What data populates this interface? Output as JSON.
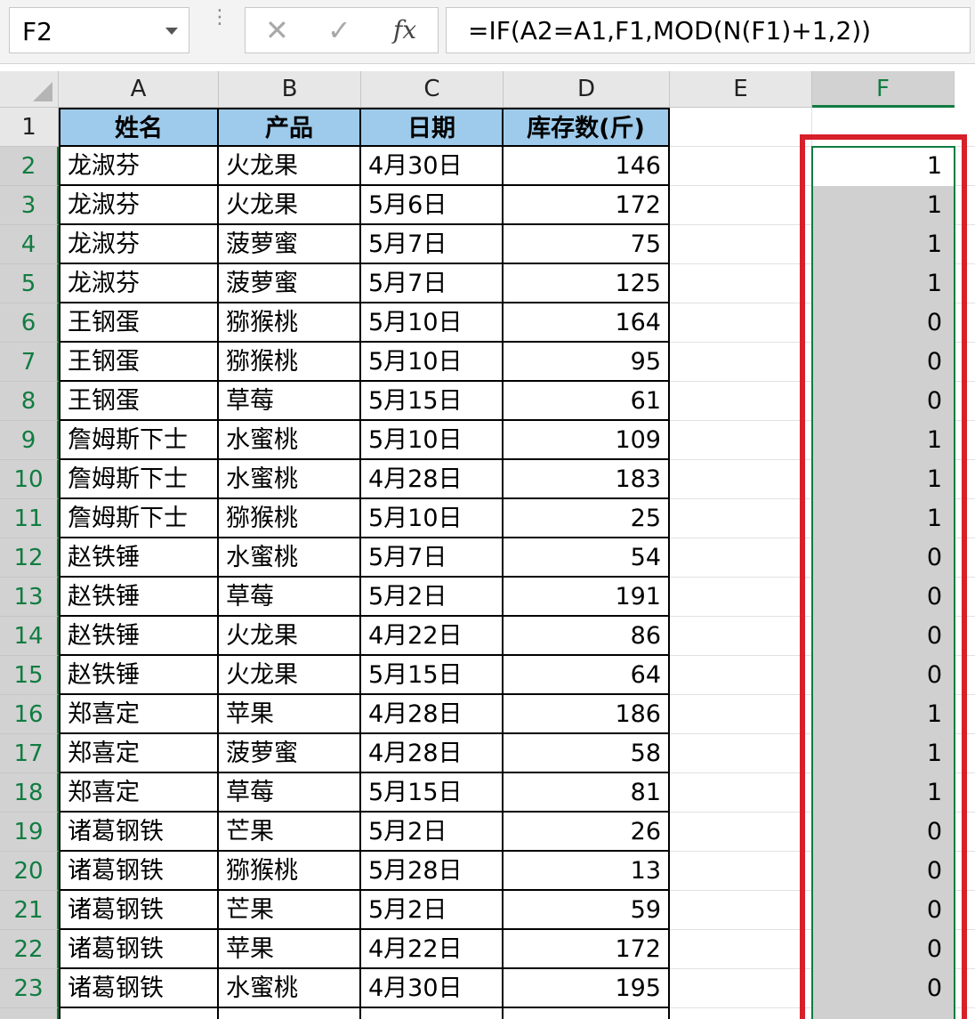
{
  "formula_bar": {
    "name_box": "F2",
    "dots": "⋮",
    "cancel": "✕",
    "enter": "✓",
    "fx": "fx",
    "formula": "=IF(A2=A1,F1,MOD(N(F1)+1,2))"
  },
  "columns": [
    "A",
    "B",
    "C",
    "D",
    "E",
    "F"
  ],
  "header_row": [
    "姓名",
    "产品",
    "日期",
    "库存数(斤)"
  ],
  "rows": [
    {
      "n": "1"
    },
    {
      "n": "2",
      "a": "龙淑芬",
      "b": "火龙果",
      "c": "4月30日",
      "d": "146",
      "f": "1"
    },
    {
      "n": "3",
      "a": "龙淑芬",
      "b": "火龙果",
      "c": "5月6日",
      "d": "172",
      "f": "1"
    },
    {
      "n": "4",
      "a": "龙淑芬",
      "b": "菠萝蜜",
      "c": "5月7日",
      "d": "75",
      "f": "1"
    },
    {
      "n": "5",
      "a": "龙淑芬",
      "b": "菠萝蜜",
      "c": "5月7日",
      "d": "125",
      "f": "1"
    },
    {
      "n": "6",
      "a": "王钢蛋",
      "b": "猕猴桃",
      "c": "5月10日",
      "d": "164",
      "f": "0"
    },
    {
      "n": "7",
      "a": "王钢蛋",
      "b": "猕猴桃",
      "c": "5月10日",
      "d": "95",
      "f": "0"
    },
    {
      "n": "8",
      "a": "王钢蛋",
      "b": "草莓",
      "c": "5月15日",
      "d": "61",
      "f": "0"
    },
    {
      "n": "9",
      "a": "詹姆斯下士",
      "b": "水蜜桃",
      "c": "5月10日",
      "d": "109",
      "f": "1"
    },
    {
      "n": "10",
      "a": "詹姆斯下士",
      "b": "水蜜桃",
      "c": "4月28日",
      "d": "183",
      "f": "1"
    },
    {
      "n": "11",
      "a": "詹姆斯下士",
      "b": "猕猴桃",
      "c": "5月10日",
      "d": "25",
      "f": "1"
    },
    {
      "n": "12",
      "a": "赵铁锤",
      "b": "水蜜桃",
      "c": "5月7日",
      "d": "54",
      "f": "0"
    },
    {
      "n": "13",
      "a": "赵铁锤",
      "b": "草莓",
      "c": "5月2日",
      "d": "191",
      "f": "0"
    },
    {
      "n": "14",
      "a": "赵铁锤",
      "b": "火龙果",
      "c": "4月22日",
      "d": "86",
      "f": "0"
    },
    {
      "n": "15",
      "a": "赵铁锤",
      "b": "火龙果",
      "c": "5月15日",
      "d": "64",
      "f": "0"
    },
    {
      "n": "16",
      "a": "郑喜定",
      "b": "苹果",
      "c": "4月28日",
      "d": "186",
      "f": "1"
    },
    {
      "n": "17",
      "a": "郑喜定",
      "b": "菠萝蜜",
      "c": "4月28日",
      "d": "58",
      "f": "1"
    },
    {
      "n": "18",
      "a": "郑喜定",
      "b": "草莓",
      "c": "5月15日",
      "d": "81",
      "f": "1"
    },
    {
      "n": "19",
      "a": "诸葛钢铁",
      "b": "芒果",
      "c": "5月2日",
      "d": "26",
      "f": "0"
    },
    {
      "n": "20",
      "a": "诸葛钢铁",
      "b": "猕猴桃",
      "c": "5月28日",
      "d": "13",
      "f": "0"
    },
    {
      "n": "21",
      "a": "诸葛钢铁",
      "b": "芒果",
      "c": "5月2日",
      "d": "59",
      "f": "0"
    },
    {
      "n": "22",
      "a": "诸葛钢铁",
      "b": "苹果",
      "c": "4月22日",
      "d": "172",
      "f": "0"
    },
    {
      "n": "23",
      "a": "诸葛钢铁",
      "b": "水蜜桃",
      "c": "4月30日",
      "d": "195",
      "f": "0"
    }
  ],
  "colors": {
    "header_fill": "#9ecbeb",
    "selection": "#107c41",
    "highlight_box": "#d6202a",
    "selected_cells": "#d0d0d0"
  }
}
